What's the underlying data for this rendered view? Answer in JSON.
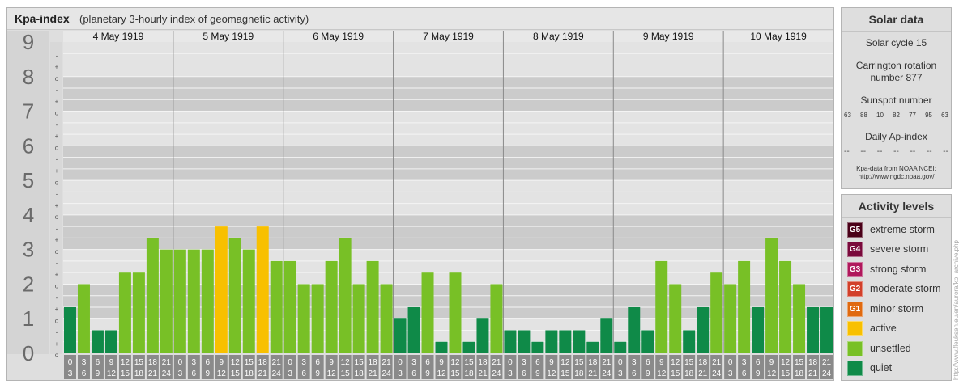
{
  "title": {
    "main": "Kpa-index",
    "sub": "(planetary 3-hourly index of geomagnetic activity)"
  },
  "chart_data": {
    "type": "bar",
    "title": "Kpa-index",
    "subtitle": "(planetary 3-hourly index of geomagnetic activity)",
    "days": [
      "4 May 1919",
      "5 May 1919",
      "6 May 1919",
      "7 May 1919",
      "8 May 1919",
      "9 May 1919",
      "10 May 1919"
    ],
    "interval_start_labels": [
      "0",
      "3",
      "6",
      "9",
      "12",
      "15",
      "18",
      "21"
    ],
    "interval_end_labels": [
      "3",
      "6",
      "9",
      "12",
      "15",
      "18",
      "21",
      "24"
    ],
    "y_major_labels": [
      "0",
      "1",
      "2",
      "3",
      "4",
      "5",
      "6",
      "7",
      "8",
      "9"
    ],
    "y_minor_marks": [
      "+",
      "o",
      "-"
    ],
    "ylim": [
      0,
      9
    ],
    "values": [
      1.333,
      2.0,
      0.667,
      0.667,
      2.333,
      2.333,
      3.333,
      3.0,
      3.0,
      3.0,
      3.0,
      3.667,
      3.333,
      3.0,
      3.667,
      2.667,
      2.667,
      2.0,
      2.0,
      2.667,
      3.333,
      2.0,
      2.667,
      2.0,
      1.0,
      1.333,
      2.333,
      0.333,
      2.333,
      0.333,
      1.0,
      2.0,
      0.667,
      0.667,
      0.333,
      0.667,
      0.667,
      0.667,
      0.333,
      1.0,
      0.333,
      1.333,
      0.667,
      2.667,
      2.0,
      0.667,
      1.333,
      2.333,
      2.0,
      2.667,
      1.333,
      3.333,
      2.667,
      2.0,
      1.333,
      1.333
    ],
    "levels": [
      "quiet",
      "unsettled",
      "quiet",
      "quiet",
      "unsettled",
      "unsettled",
      "unsettled",
      "unsettled",
      "unsettled",
      "unsettled",
      "unsettled",
      "active",
      "unsettled",
      "unsettled",
      "active",
      "unsettled",
      "unsettled",
      "unsettled",
      "unsettled",
      "unsettled",
      "unsettled",
      "unsettled",
      "unsettled",
      "unsettled",
      "quiet",
      "quiet",
      "unsettled",
      "quiet",
      "unsettled",
      "quiet",
      "quiet",
      "unsettled",
      "quiet",
      "quiet",
      "quiet",
      "quiet",
      "quiet",
      "quiet",
      "quiet",
      "quiet",
      "quiet",
      "quiet",
      "quiet",
      "unsettled",
      "unsettled",
      "quiet",
      "quiet",
      "unsettled",
      "unsettled",
      "unsettled",
      "quiet",
      "unsettled",
      "unsettled",
      "unsettled",
      "quiet",
      "quiet"
    ],
    "level_colors": {
      "quiet": "#0f8a48",
      "unsettled": "#78c026",
      "active": "#f8c000"
    },
    "grid": true
  },
  "solar": {
    "title": "Solar data",
    "cycle": "Solar cycle 15",
    "carrington_line1": "Carrington rotation",
    "carrington_line2": "number 877",
    "sunspot_title": "Sunspot number",
    "sunspot_values": [
      "63",
      "88",
      "10",
      "82",
      "77",
      "95",
      "63"
    ],
    "ap_title": "Daily Ap-index",
    "ap_values": [
      "--",
      "--",
      "--",
      "--",
      "--",
      "--",
      "--"
    ],
    "source_line1": "Kpa-data from NOAA NCEI:",
    "source_line2": "http://www.ngdc.noaa.gov/"
  },
  "activity": {
    "title": "Activity levels",
    "items": [
      {
        "badge": "G5",
        "label": "extreme storm",
        "color": "#4a0018"
      },
      {
        "badge": "G4",
        "label": "severe storm",
        "color": "#7a0a3c"
      },
      {
        "badge": "G3",
        "label": "strong storm",
        "color": "#b0185c"
      },
      {
        "badge": "G2",
        "label": "moderate storm",
        "color": "#d2402a"
      },
      {
        "badge": "G1",
        "label": "minor storm",
        "color": "#e06a10"
      },
      {
        "badge": "",
        "label": "active",
        "color": "#f8c000"
      },
      {
        "badge": "",
        "label": "unsettled",
        "color": "#78c026"
      },
      {
        "badge": "",
        "label": "quiet",
        "color": "#0f8a48"
      }
    ]
  },
  "credit": "http://www.fleuksen.eu/en/aurora/kp_archive.php"
}
